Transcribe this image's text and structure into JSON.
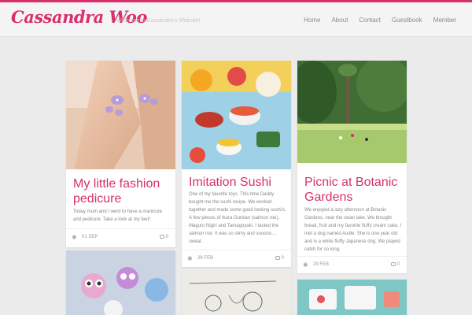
{
  "header": {
    "logo": "Cassandra Woo",
    "tagline": "Welcome to Cassandra's Website!",
    "nav": [
      "Home",
      "About",
      "Contact",
      "Guestbook",
      "Member"
    ]
  },
  "posts": [
    {
      "title": "My little fashion pedicure",
      "text": "Today mum and I went to have a manicure and pedicure. Take a look at my feet!",
      "date": "01 SEP",
      "comments": "0",
      "image": "painted-toenails-photo"
    },
    {
      "title": "Imitation Sushi",
      "text": "One of my favorite toys. This time Daddy bought me the sushi recipe. We worked together and made some good looking sushi's. A few pieces of Ikura Gunkan (salmon roe), Maguro Nigiri and Tamagoyaki. I tasted the salmon roe. It was so slimy and sooooo.... sweat.",
      "date": "28 FEB",
      "comments": "0",
      "image": "toy-sushi-photo"
    },
    {
      "title": "Picnic at Botanic Gardens",
      "text": "We enjoyed a lazy afternoon at Botanic Gardens, near the swan lake. We brought bread, fruit and my favorite fluffy cream cake. I met a dog named Audie. She is one year old and is a white fluffy Japanese dog. We played catch for so long.",
      "date": "29 FEB",
      "comments": "0",
      "image": "botanic-gardens-photo"
    },
    {
      "image": "littlest-pet-shop-toys-photo"
    },
    {
      "image": "pencil-drawing-photo"
    },
    {
      "image": "cartoon-illustration-photo"
    }
  ],
  "colors": {
    "accent": "#d8306e",
    "background": "#ebebeb"
  }
}
